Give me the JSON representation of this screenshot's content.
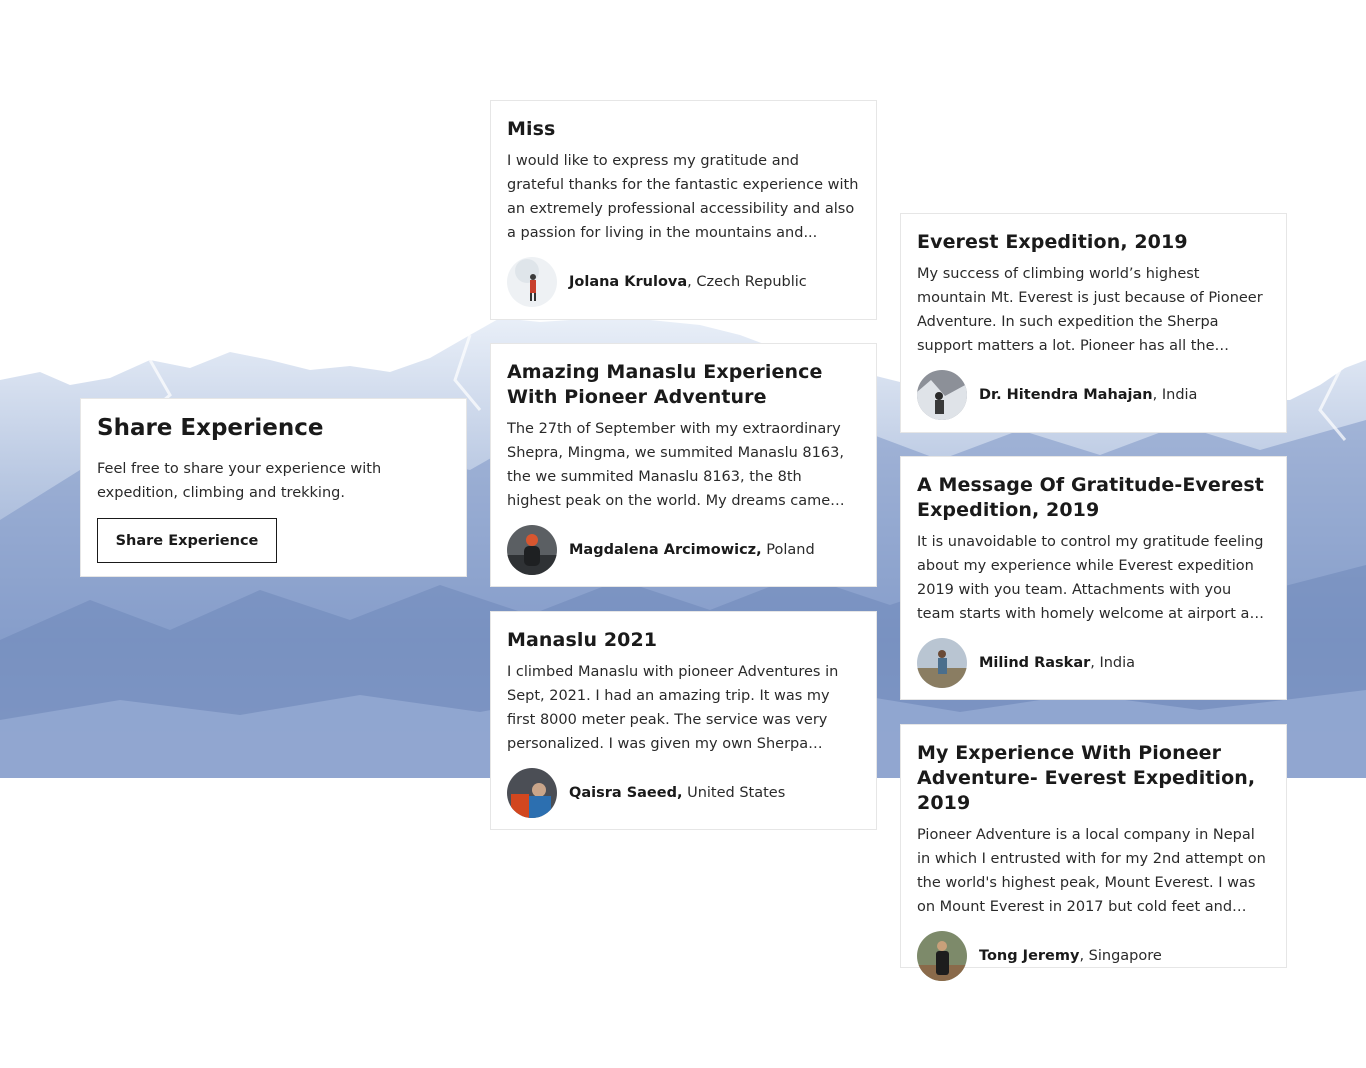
{
  "colors": {
    "card_bg": "#ffffff",
    "card_border": "#e6e6e6",
    "mountain_light": "#e8eef7",
    "mountain_mid": "#9fb3d6",
    "mountain_dark": "#5a73a3",
    "text": "#1a1a1a"
  },
  "share": {
    "title": "Share Experience",
    "text": "Feel free to share your experience with expedition, climbing and trekking.",
    "button_label": "Share Experience"
  },
  "testimonials": [
    {
      "title": "Miss",
      "text": "I would like to express my gratitude and grateful thanks for the fantastic experience with an extremely professional accessibility and also a passion for living in the mountains and...",
      "author": "Jolana Krulova",
      "location": ", Czech Republic"
    },
    {
      "title": "Amazing Manaslu Experience With Pioneer Adventure",
      "text": "The 27th of September with my extraordinary Shepra, Mingma, we summited Manaslu 8163, the we summited Manaslu 8163, the 8th highest peak on the world. My dreams came true...",
      "author": "Magdalena Arcimowicz,",
      "location": " Poland"
    },
    {
      "title": "Manaslu 2021",
      "text": "I climbed Manaslu with pioneer Adventures in Sept, 2021. I had an amazing trip. It was my first 8000 meter peak. The service was very personalized. I was given my own Sherpa Lakpa...",
      "author": "Qaisra Saeed,",
      "location": " United States"
    },
    {
      "title": "Everest Expedition, 2019",
      "text": "My success of climbing world’s highest mountain Mt. Everest is just because of Pioneer Adventure. In such expedition the Sherpa support matters a lot. Pioneer has all the qualified Sherpas with...",
      "author": "Dr. Hitendra Mahajan",
      "location": ", India"
    },
    {
      "title": "A Message Of Gratitude-Everest Expedition, 2019",
      "text": "It is unavoidable to control my gratitude feeling about my experience while Everest expedition 2019 with you team. Attachments with you team starts with homely welcome at airport and with...",
      "author": "Milind Raskar",
      "location": ", India"
    },
    {
      "title": "My Experience With Pioneer Adventure- Everest Expedition, 2019",
      "text": "Pioneer Adventure is a local company in Nepal in which I entrusted with for my 2nd attempt on the world's highest peak, Mount Everest. I was on Mount Everest in 2017 but cold feet and hands...",
      "author": "Tong Jeremy",
      "location": ", Singapore"
    }
  ]
}
